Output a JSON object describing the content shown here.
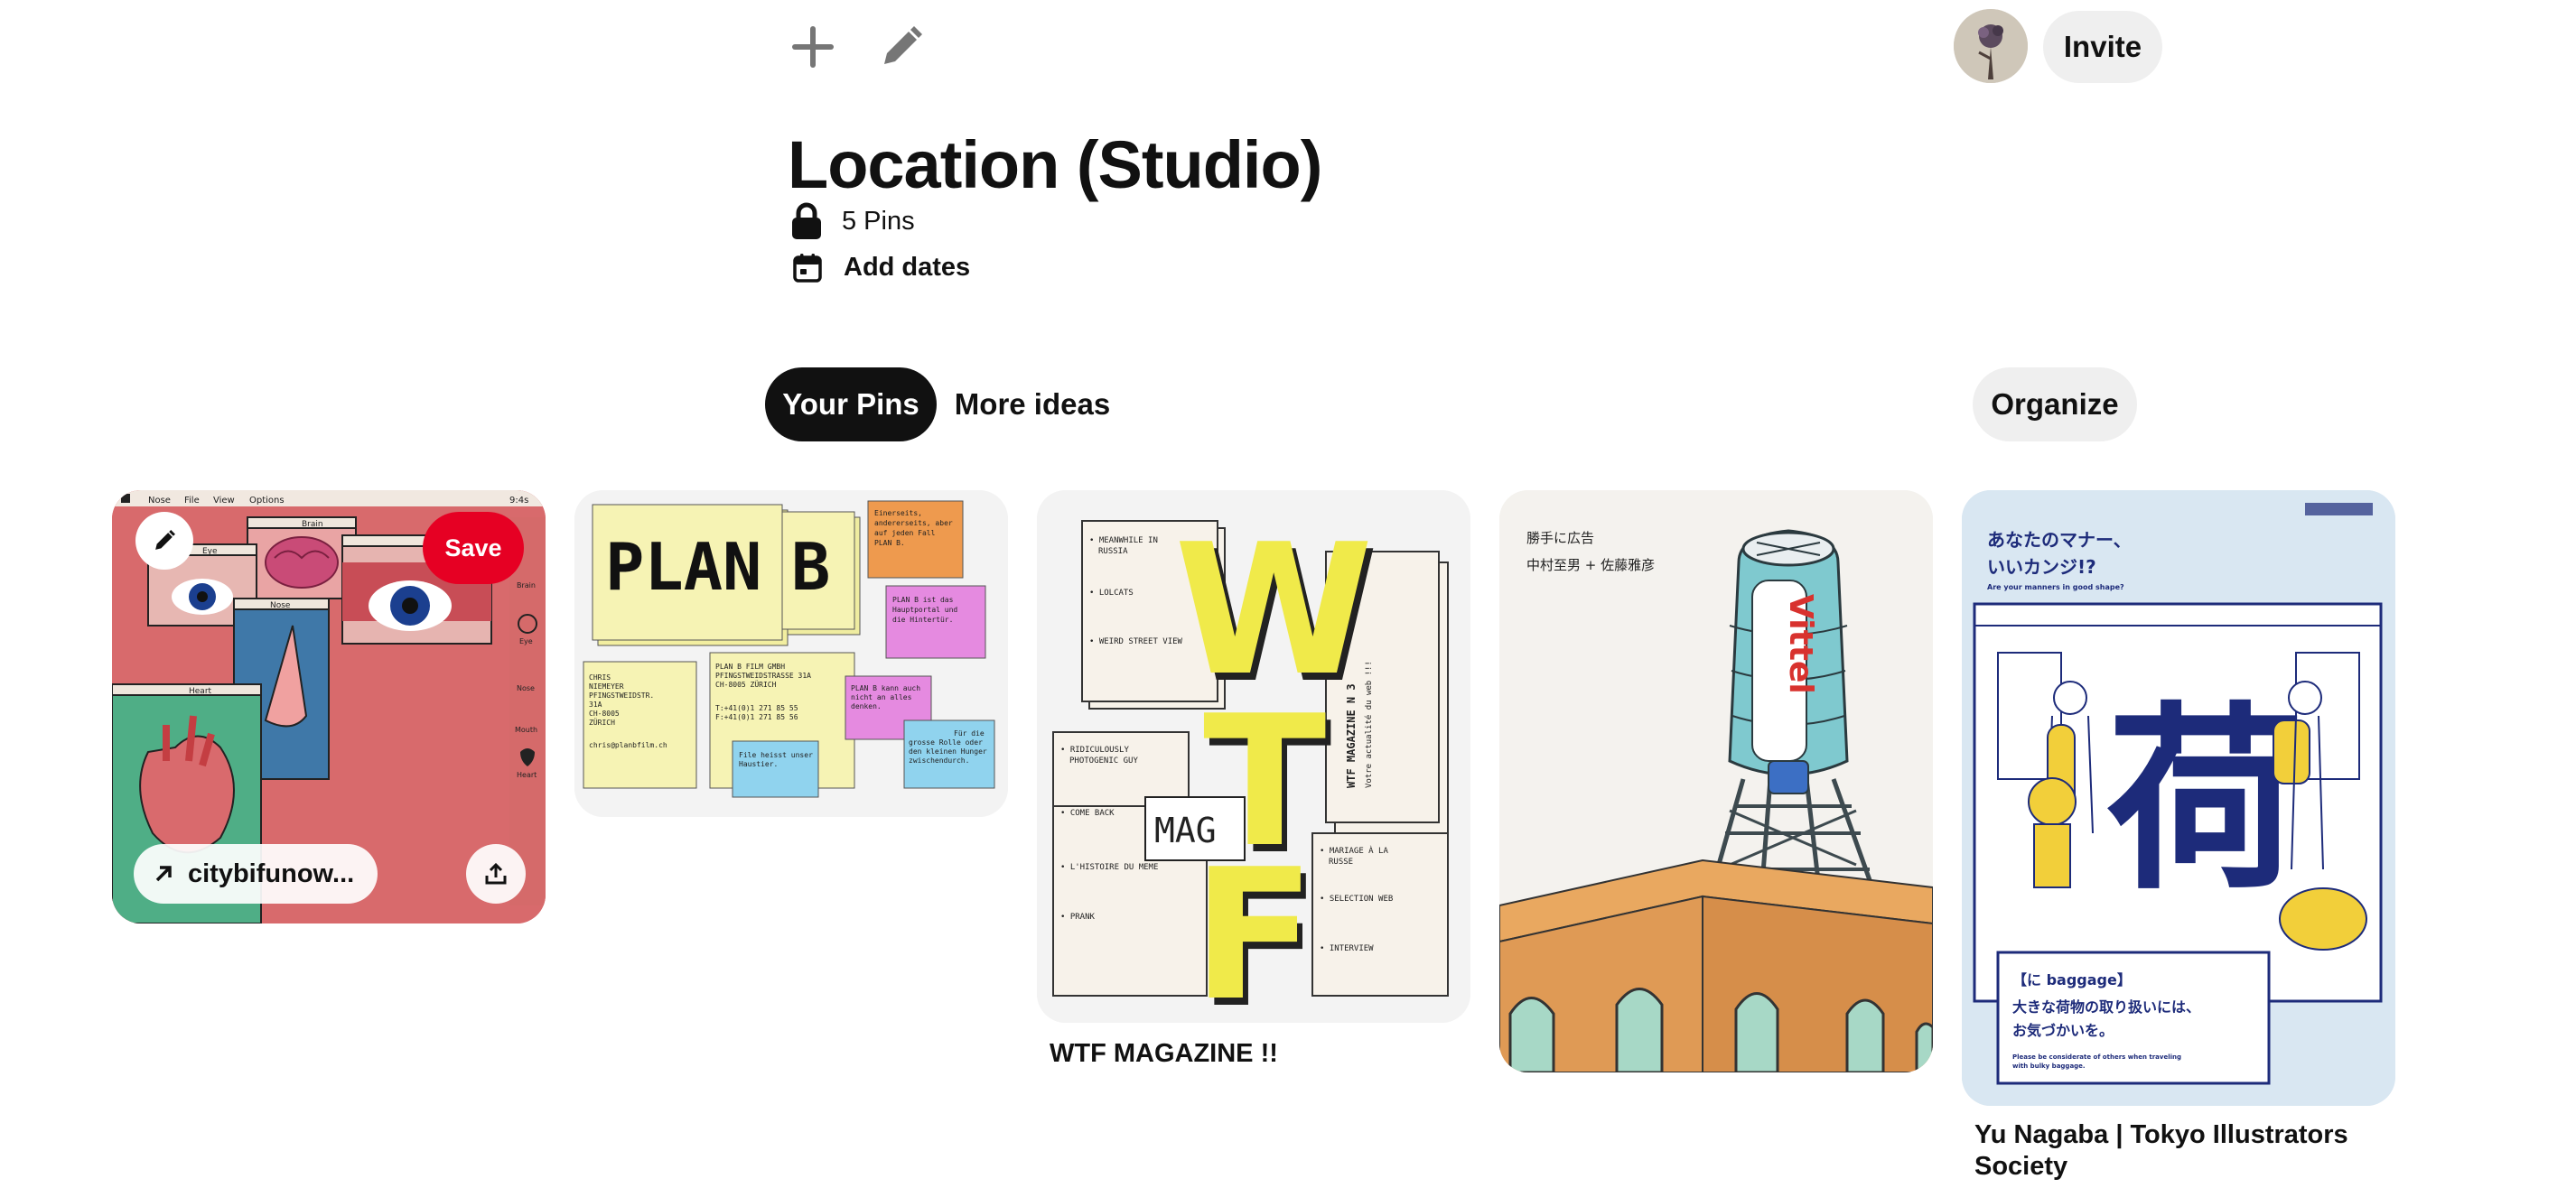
{
  "header": {
    "add_icon": "plus-icon",
    "edit_icon": "pencil-icon",
    "invite_label": "Invite"
  },
  "board": {
    "title": "Location (Studio)",
    "pin_count": "5 Pins",
    "add_dates_label": "Add dates",
    "privacy_icon": "lock-icon",
    "calendar_icon": "calendar-icon"
  },
  "tabs": {
    "your_pins": "Your Pins",
    "more_ideas": "More ideas",
    "organize": "Organize"
  },
  "pins": [
    {
      "link_label": "citybifunow...",
      "save_label": "Save",
      "image": {
        "menu": [
          "Nose",
          "File",
          "View",
          "Options"
        ],
        "clock": "9:4s",
        "windows": [
          "Eye",
          "Brain",
          "Nose",
          "Heart"
        ],
        "side_labels": [
          "Brain",
          "Eye",
          "Nose",
          "Mouth",
          "Heart"
        ]
      }
    },
    {
      "image": {
        "big_left": "PLAN",
        "big_right": "B",
        "notes": [
          "Einerseits, andererseits, aber auf jeden Fall PLAN B.",
          "PLAN B ist das Hauptportal und die Hintertür.",
          "CHRIS NIEMEYER PFINGSTWEIDSTR. 31A CH-8005 ZÜRICH chris@planbfilm.ch",
          "PLAN B FILM GMBH PFINGSTWEIDSTRASSE 31A CH-8005 ZÜRICH T:+41(0)1 271 85 55 F:+41(0)1 271 85 56",
          "PLAN B kann auch nicht an alles denken.",
          "File heisst unser Haustier.",
          "Für die grosse Rolle oder den kleinen Hunger zwischendurch."
        ]
      }
    },
    {
      "caption": "WTF MAGAZINE !!",
      "image": {
        "letters": [
          "W",
          "T",
          "F"
        ],
        "mag": "MAG",
        "side": "WTF MAGAZINE N 3",
        "side_sub": "Votre actualité du web !!!",
        "items_top": [
          "MEANWHILE IN RUSSIA",
          "LOLCATS",
          "WEIRD STREET VIEW"
        ],
        "items_mid": [
          "RIDICULOUSLY PHOTOGENIC GUY",
          "COME BACK",
          "L'HISTOIRE DU MEME",
          "PRANK"
        ],
        "items_bottom": [
          "MARIAGE À LA RUSSE",
          "SELECTION WEB",
          "INTERVIEW"
        ]
      }
    },
    {
      "image": {
        "line1": "勝手に広告",
        "line2": "中村至男 + 佐藤雅彦",
        "brand": "Vittel"
      }
    },
    {
      "caption": "Yu Nagaba | Tokyo Illustrators Society",
      "image": {
        "heading": "あなたのマナー、いいカンジ!?",
        "subheading": "Are your manners in good shape?",
        "kanji": "荷",
        "box_title": "【に baggage】",
        "box_line1": "大きな荷物の取り扱いには、",
        "box_line2": "お気づかいを。",
        "box_en": "Please be considerate of others when traveling with bulky baggage."
      }
    }
  ],
  "colors": {
    "save": "#e60023",
    "pill": "#efefef",
    "active_tab": "#111111"
  }
}
